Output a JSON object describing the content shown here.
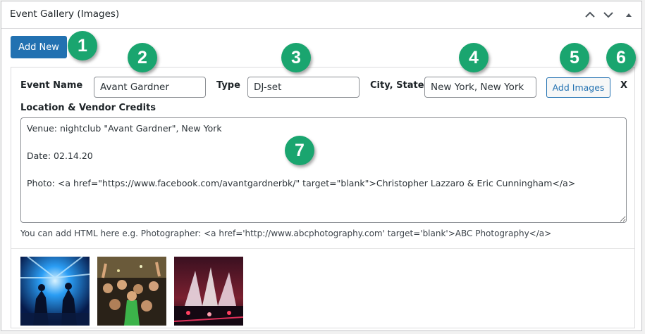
{
  "panel": {
    "title": "Event Gallery (Images)",
    "move_up_icon": "chevron-up-icon",
    "move_down_icon": "chevron-down-icon",
    "toggle_icon": "triangle-up-icon"
  },
  "add_new_label": "Add New",
  "badges": [
    "1",
    "2",
    "3",
    "4",
    "5",
    "6",
    "7"
  ],
  "badge_color": "#1aa56f",
  "accent": "#2271b1",
  "event": {
    "name_label": "Event Name",
    "name_value": "Avant Gardner",
    "type_label": "Type",
    "type_value": "DJ-set",
    "city_label": "City, State",
    "city_value": "New York, New York",
    "add_images_label": "Add Images",
    "remove_label": "X",
    "credits_label": "Location & Vendor Credits",
    "credits_value": "Venue: nightclub \"Avant Gardner\", New York\n\nDate: 02.14.20\n\nPhoto: <a href=\"https://www.facebook.com/avantgardnerbk/\" target=\"blank\">Christopher Lazzaro & Eric Cunningham</a>",
    "help_text": "You can add HTML here e.g. Photographer: <a href='http://www.abcphotography.com' target='blank'>ABC Photography</a>"
  },
  "thumbnails": [
    {
      "desc": "dj-silhouettes-blue-lights"
    },
    {
      "desc": "crowd-green-confetti"
    },
    {
      "desc": "stage-smoke-jets"
    }
  ]
}
